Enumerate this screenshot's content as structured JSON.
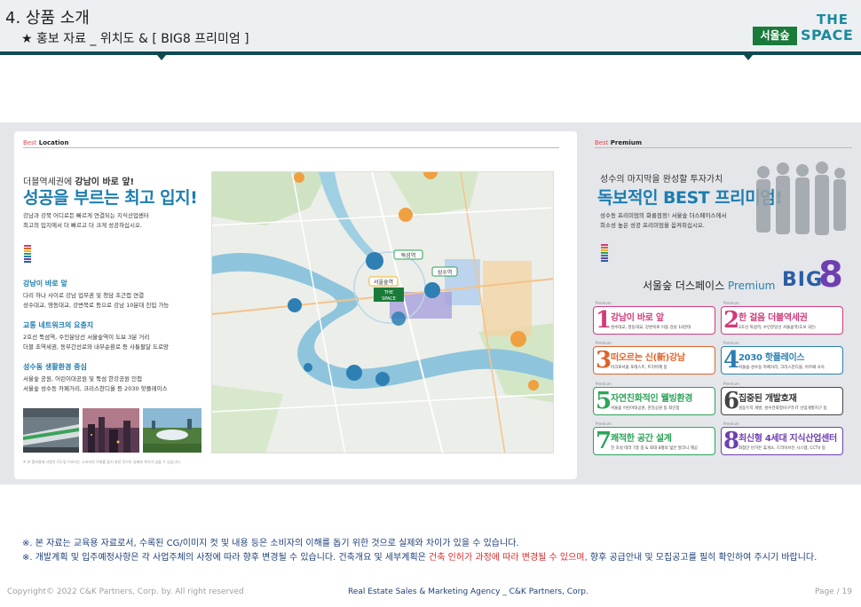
{
  "header": {
    "title": "4. 상품 소개",
    "subtitle": "★ 홍보 자료 _ 위치도 & [ BIG8 프리미엄 ]",
    "logo": {
      "the": "THE",
      "space": "SPACE",
      "brand_box": "서울숲"
    }
  },
  "location": {
    "section_label_prefix": "Best",
    "section_label": "Location",
    "lead_small_prefix": "더블역세권에",
    "lead_small_bold": "강남이 바로 앞!",
    "lead_big": "성공을 부르는 최고 입지!",
    "lead_desc_1": "강남과 강북 어디로든 빠르게 연결되는 지식산업센터",
    "lead_desc_2": "최고의 입지에서 더 빠르고 더 크게 성공하십시오.",
    "features": [
      {
        "title": "강남이 바로 앞",
        "desc_1": "다리 하나 사이로 강남 업무권 및 청담 초근접 연결",
        "desc_2": "성수대교, 영동대교, 강변북로 등으로 강남 10분대 진입 가능"
      },
      {
        "title": "교통 네트워크의 요충지",
        "desc_1": "2호선 뚝섬역, 수인분당선 서울숲역이 도보 3분 거리",
        "desc_2": "더블 초역세권, 동부간선로와 내부순환로 등 사통팔달 도로망"
      },
      {
        "title": "성수동 생활환경 중심",
        "desc_1": "서울숲 공원, 어린이대공원 및 뚝섬 한강공원 인접",
        "desc_2": "서울숲 성수동 카페거리, 크리스찬디올 등 2030 핫플레이스"
      }
    ],
    "footnote": "※ 본 홍보물에 사용된 CG 및 이미지는 소비자의 이해를 돕기 위한 것으로 실제와 차이가 있을 수 있습니다."
  },
  "premium": {
    "section_label_prefix": "Best",
    "section_label": "Premium",
    "lead_small": "성수의 마지막을 완성할 투자가치",
    "lead_big": "독보적인 BEST 프리미엄!",
    "lead_desc_1": "성수동 프리미엄의 화룡점정! 서울숲 더스페이스에서",
    "lead_desc_2": "희소성 높은 성공 프리미엄을 움켜쥐십시오.",
    "big8_heading_1": "서울숲 더스페이스",
    "big8_heading_2": "Premium",
    "big8_word": "BIG",
    "big8_num": "8",
    "cards": [
      {
        "num": "1",
        "title": "강남이 바로 앞",
        "desc": "성수대교, 영동대교, 강변북로 이용 강남 10분대",
        "color": "#d23b7a"
      },
      {
        "num": "2",
        "title": "한 걸음 더블역세권",
        "desc": "2호선 뚝섬역, 수인분당선 서울숲역(도보 3분)",
        "color": "#d23b7a"
      },
      {
        "num": "3",
        "title": "떠오르는 신(新)강남",
        "desc": "아크로서울 포레스트, 트리마제 등",
        "color": "#e0632a"
      },
      {
        "num": "4",
        "title": "2030 핫플레이스",
        "desc": "서울숲·성수동 카페거리, 크리스찬디올, 아르떼 사옥",
        "color": "#2a7fb2"
      },
      {
        "num": "5",
        "title": "자연친화적인 웰빙환경",
        "desc": "서울숲 어린이대공원, 한강공원 등 최인접",
        "color": "#2ea35a"
      },
      {
        "num": "6",
        "title": "집중된 개발호재",
        "desc": "성동두지 개발, 성수전략정비구역·IT 산업개발지구 등",
        "color": "#444444"
      },
      {
        "num": "7",
        "title": "쾌적한 공간 설계",
        "desc": "전 호실 테라 7층 중 & 최대 8평의 넓은 발코니 제공",
        "color": "#2ea35a"
      },
      {
        "num": "8",
        "title": "최신형 4세대 지식산업센터",
        "desc": "최첨단 빈가든 휴게소, 드라이브인 시스템, CCTV 등",
        "color": "#6e3fb0"
      }
    ],
    "premium_tag": "Premium"
  },
  "map": {
    "labels": [
      "뚝섬역",
      "서울숲역",
      "서울숲",
      "성수역"
    ],
    "badge_the": "THE",
    "badge_space": "SPACE"
  },
  "notes": {
    "line1": "※. 본 자료는 교육용 자료로서, 수록된 CG/이미지 컷 및 내용 등은 소비자의 이해를 돕기 위한 것으로 실제와 차이가 있을 수 있습니다.",
    "line2_a": "※. 개발계획 및 입주예정사항은 각 사업주체의 사정에 따라 향후 변경될 수 있습니다. 건축개요 및 세부계획은 ",
    "line2_red": "건축 인허가 과정에 따라 변경될 수 있으며,",
    "line2_b": " 향후 공급안내 및 모집공고를 필히 확인하여 주시기 바랍니다."
  },
  "footer": {
    "copyright": "Copyright© 2022 C&K Partners, Corp. by. All right reserved",
    "agency": "Real Estate Sales & Marketing Agency _ C&K Partners, Corp.",
    "page": "Page / 19"
  },
  "colors": {
    "accent": "#0f4a52",
    "blue": "#1c7db0",
    "navy": "#1d3f7a",
    "red": "#d42a2a"
  }
}
